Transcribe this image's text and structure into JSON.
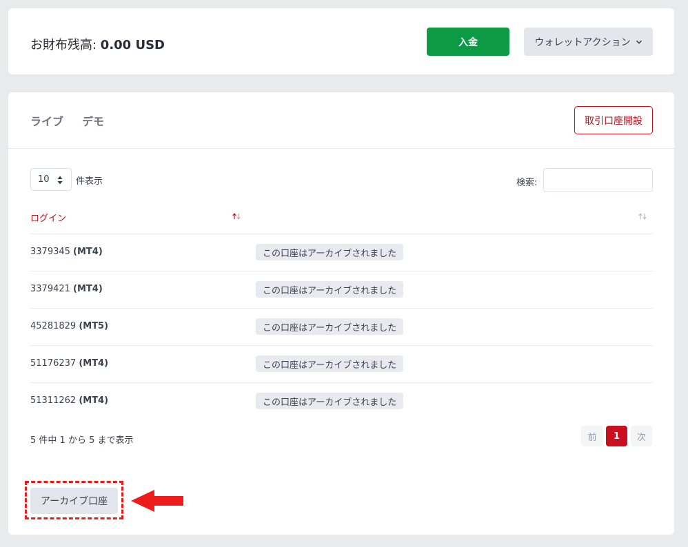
{
  "balance": {
    "label": "お財布残高: ",
    "amount": "0.00 USD"
  },
  "actions": {
    "deposit_label": "入金",
    "wallet_label": "ウォレットアクション"
  },
  "tabs": {
    "live": "ライブ",
    "demo": "デモ"
  },
  "open_account_label": "取引口座開設",
  "table_controls": {
    "page_length": "10",
    "length_label": "件表示",
    "search_label": "検索:",
    "search_value": ""
  },
  "table": {
    "columns": {
      "login": "ログイン",
      "status": ""
    },
    "rows": [
      {
        "login": "3379345",
        "platform": "(MT4)",
        "status": "この口座はアーカイブされました"
      },
      {
        "login": "3379421",
        "platform": "(MT4)",
        "status": "この口座はアーカイブされました"
      },
      {
        "login": "45281829",
        "platform": "(MT5)",
        "status": "この口座はアーカイブされました"
      },
      {
        "login": "51176237",
        "platform": "(MT4)",
        "status": "この口座はアーカイブされました"
      },
      {
        "login": "51311262",
        "platform": "(MT4)",
        "status": "この口座はアーカイブされました"
      }
    ]
  },
  "pagination": {
    "info": "5 件中 1 から 5 まで表示",
    "prev": "前",
    "current": "1",
    "next": "次"
  },
  "archive_label": "アーカイブ口座",
  "colors": {
    "accent": "#c8101e",
    "deposit": "#0d9a45",
    "annotation": "#ee1b1b"
  }
}
